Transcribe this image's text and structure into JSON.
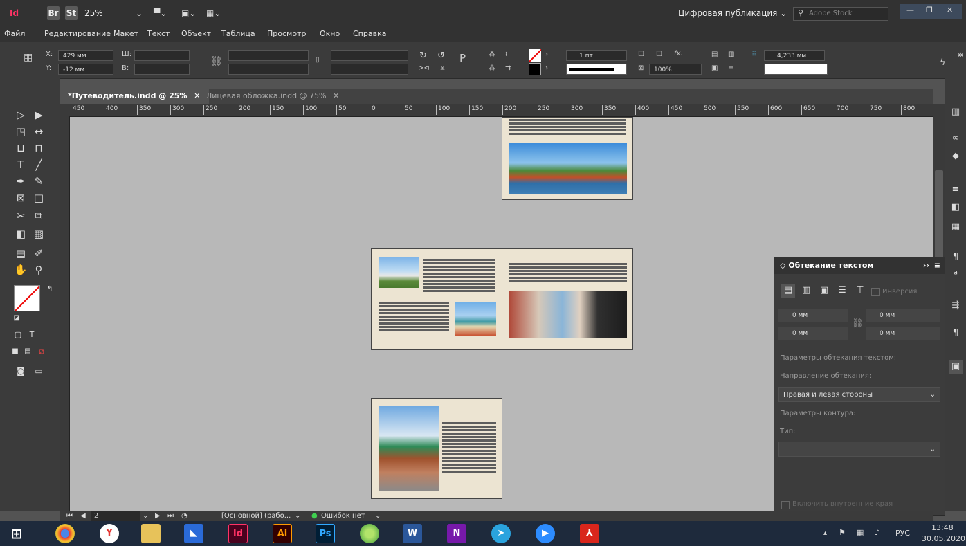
{
  "app": {
    "bridge_chip": "Br",
    "stock_chip": "St",
    "zoom": "25%",
    "workspace": "Цифровая публикация",
    "search_placeholder": "Adobe Stock"
  },
  "menu": [
    "Файл",
    "Редактирование",
    "Макет",
    "Текст",
    "Объект",
    "Таблица",
    "Просмотр",
    "Окно",
    "Справка"
  ],
  "control": {
    "x_label": "X:",
    "x_value": "429 мм",
    "y_label": "Y:",
    "y_value": "-12 мм",
    "w_label": "Ш:",
    "h_label": "В:",
    "stroke_weight": "1 пт",
    "opacity": "100%",
    "offset": "4,233 мм"
  },
  "tabs": [
    {
      "label": "*Путеводитель.indd @ 25%"
    },
    {
      "label": "Лицевая обложка.indd @ 75%"
    }
  ],
  "ruler_labels": [
    "450",
    "400",
    "350",
    "300",
    "250",
    "200",
    "150",
    "100",
    "50",
    "0",
    "50",
    "100",
    "150",
    "200",
    "250",
    "300",
    "350",
    "400",
    "450",
    "500",
    "550",
    "600",
    "650",
    "700",
    "750",
    "800"
  ],
  "text_wrap_panel": {
    "title": "Обтекание текстом",
    "invert_label": "Инверсия",
    "top_offset": "0 мм",
    "bottom_offset": "0 мм",
    "left_offset": "0 мм",
    "right_offset": "0 мм",
    "wrap_options_label": "Параметры обтекания текстом:",
    "wrap_direction_label": "Направление обтекания:",
    "wrap_direction_value": "Правая и левая стороны",
    "contour_options_label": "Параметры контура:",
    "type_label": "Тип:",
    "type_value": "",
    "include_inside_edges": "Включить внутренние края"
  },
  "status": {
    "page_number": "2",
    "master": "[Основной] (рабо...",
    "preflight": "Ошибок нет"
  },
  "taskbar": {
    "time": "13:48",
    "date": "30.05.2020",
    "language": "РУС",
    "apps": [
      "Id",
      "Ai",
      "Ps",
      "W",
      "N"
    ]
  }
}
